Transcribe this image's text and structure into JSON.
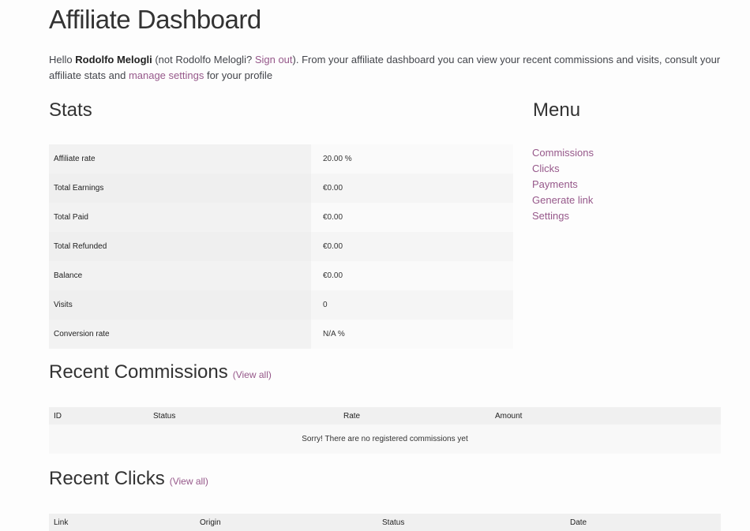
{
  "title": "Affiliate Dashboard",
  "intro": {
    "hello": "Hello ",
    "name": "Rodolfo Melogli",
    "not_prefix": " (not Rodolfo Melogli? ",
    "sign_out": "Sign out",
    "after_sign_out": "). From your affiliate dashboard you can view your recent commissions and visits, consult your affiliate stats and ",
    "manage_settings": "manage settings",
    "tail": " for your profile"
  },
  "stats": {
    "title": "Stats",
    "rows": [
      {
        "label": "Affiliate rate",
        "value": "20.00 %"
      },
      {
        "label": "Total Earnings",
        "value": "€0.00"
      },
      {
        "label": "Total Paid",
        "value": "€0.00"
      },
      {
        "label": "Total Refunded",
        "value": "€0.00"
      },
      {
        "label": "Balance",
        "value": "€0.00"
      },
      {
        "label": "Visits",
        "value": "0"
      },
      {
        "label": "Conversion rate",
        "value": "N/A %"
      }
    ]
  },
  "menu": {
    "title": "Menu",
    "items": [
      "Commissions",
      "Clicks",
      "Payments",
      "Generate link",
      "Settings"
    ]
  },
  "commissions": {
    "title": "Recent Commissions",
    "view_all": "(View all)",
    "columns": [
      "ID",
      "Status",
      "Rate",
      "Amount"
    ],
    "empty": "Sorry! There are no registered commissions yet"
  },
  "clicks": {
    "title": "Recent Clicks",
    "view_all": "(View all)",
    "columns": [
      "Link",
      "Origin",
      "Status",
      "Date"
    ]
  },
  "colors": {
    "link": "#96588a",
    "text": "#43454b"
  }
}
